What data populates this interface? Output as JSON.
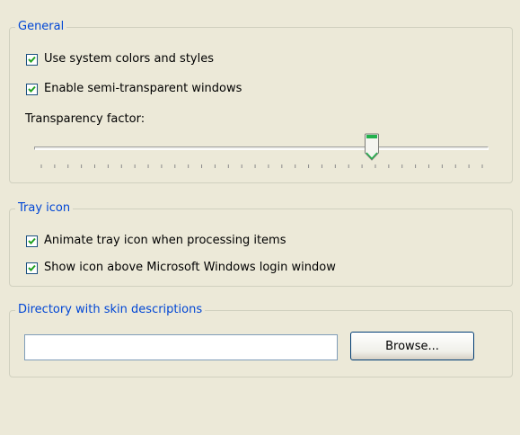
{
  "general": {
    "legend": "General",
    "use_system_colors": {
      "label": "Use system colors and styles",
      "checked": true
    },
    "semi_transparent": {
      "label": "Enable semi-transparent windows",
      "checked": true
    },
    "transparency_label": "Transparency factor:",
    "transparency_level": 0.75,
    "tick_count": 34
  },
  "tray": {
    "legend": "Tray icon",
    "animate": {
      "label": "Animate tray icon when processing items",
      "checked": true
    },
    "show_above_login": {
      "label": "Show icon above Microsoft Windows login window",
      "checked": true
    }
  },
  "skin": {
    "legend": "Directory with skin descriptions",
    "path_value": "",
    "browse_label": "Browse..."
  },
  "colors": {
    "legend_blue": "#0046d5",
    "checkmark_green": "#21a121",
    "background": "#ece9d8"
  }
}
